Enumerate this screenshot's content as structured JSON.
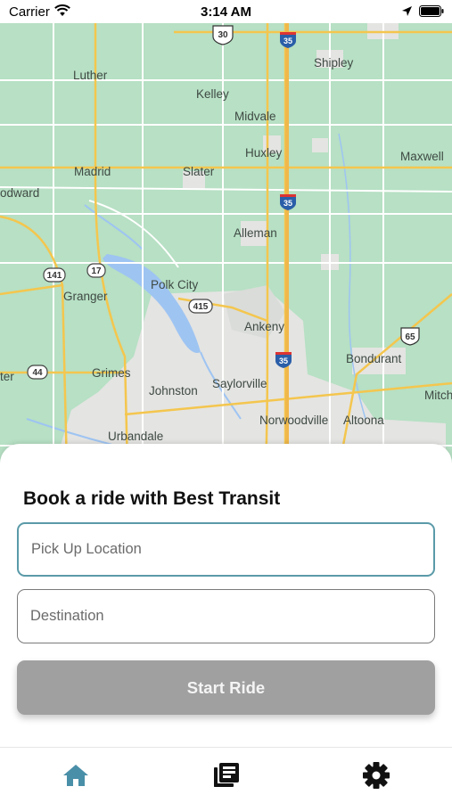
{
  "status_bar": {
    "carrier": "Carrier",
    "time": "3:14 AM"
  },
  "map": {
    "towns": [
      {
        "name": "Luther"
      },
      {
        "name": "Kelley"
      },
      {
        "name": "Midvale"
      },
      {
        "name": "Shipley"
      },
      {
        "name": "Huxley"
      },
      {
        "name": "Maxwell"
      },
      {
        "name": "Madrid"
      },
      {
        "name": "Slater"
      },
      {
        "name": "odward"
      },
      {
        "name": "Alleman"
      },
      {
        "name": "Granger"
      },
      {
        "name": "Polk City"
      },
      {
        "name": "Ankeny"
      },
      {
        "name": "Bondurant"
      },
      {
        "name": "ter"
      },
      {
        "name": "Grimes"
      },
      {
        "name": "Johnston"
      },
      {
        "name": "Saylorville"
      },
      {
        "name": "Mitch"
      },
      {
        "name": "Norwoodville"
      },
      {
        "name": "Altoona"
      },
      {
        "name": "Urbandale"
      }
    ],
    "shields": {
      "us30": "30",
      "i35_north": "35",
      "i35_mid": "35",
      "i35_south": "35",
      "ia141": "141",
      "ia17": "17",
      "ia415": "415",
      "us65": "65",
      "ia44": "44"
    }
  },
  "booking": {
    "title": "Book a ride with Best Transit",
    "pickup_placeholder": "Pick Up Location",
    "pickup_value": "",
    "destination_placeholder": "Destination",
    "destination_value": "",
    "start_label": "Start Ride"
  },
  "tabs": [
    {
      "icon": "home-icon",
      "active": true
    },
    {
      "icon": "news-icon",
      "active": false
    },
    {
      "icon": "gear-icon",
      "active": false
    }
  ],
  "colors": {
    "active_tab": "#4a8fa8",
    "inactive_tab": "#111111",
    "button_disabled": "#a0a0a0",
    "input_focus_border": "#5a9aa8"
  }
}
